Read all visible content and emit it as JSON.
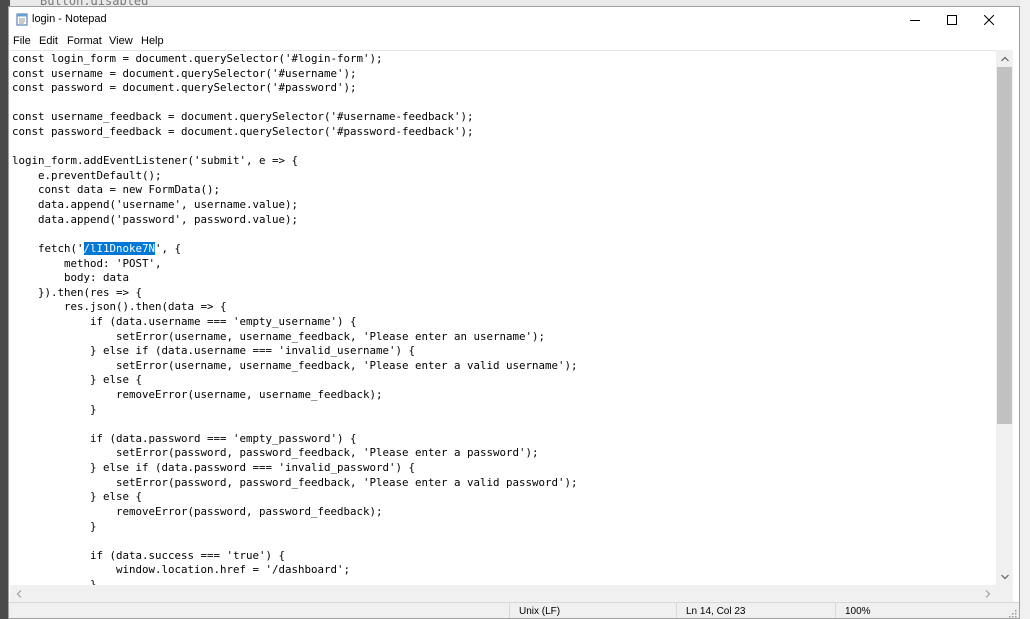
{
  "background": {
    "peek_text": "    Button.disabled"
  },
  "window": {
    "title": "login - Notepad"
  },
  "menu": {
    "items": [
      {
        "label": "File"
      },
      {
        "label": "Edit"
      },
      {
        "label": "Format"
      },
      {
        "label": "View"
      },
      {
        "label": "Help"
      }
    ]
  },
  "editor": {
    "selected_text": "/lI1Dnoke7N",
    "lines": [
      "const login_form = document.querySelector('#login-form');",
      "const username = document.querySelector('#username');",
      "const password = document.querySelector('#password');",
      "",
      "const username_feedback = document.querySelector('#username-feedback');",
      "const password_feedback = document.querySelector('#password-feedback');",
      "",
      "login_form.addEventListener('submit', e => {",
      "    e.preventDefault();",
      "    const data = new FormData();",
      "    data.append('username', username.value);",
      "    data.append('password', password.value);",
      "",
      "    fetch('",
      "        method: 'POST',",
      "        body: data",
      "    }).then(res => {",
      "        res.json().then(data => {",
      "            if (data.username === 'empty_username') {",
      "                setError(username, username_feedback, 'Please enter an username');",
      "            } else if (data.username === 'invalid_username') {",
      "                setError(username, username_feedback, 'Please enter a valid username');",
      "            } else {",
      "                removeError(username, username_feedback);",
      "            }",
      "",
      "            if (data.password === 'empty_password') {",
      "                setError(password, password_feedback, 'Please enter a password');",
      "            } else if (data.password === 'invalid_password') {",
      "                setError(password, password_feedback, 'Please enter a valid password');",
      "            } else {",
      "                removeError(password, password_feedback);",
      "            }",
      "",
      "            if (data.success === 'true') {",
      "                window.location.href = '/dashboard';",
      "            }"
    ],
    "fetch_line_suffix": "', {"
  },
  "status": {
    "line_ending": "Unix (LF)",
    "position": "Ln 14, Col 23",
    "zoom": "100%"
  },
  "colors": {
    "selection": "#0078d7",
    "scrollbar_track": "#f0f0f0",
    "scrollbar_thumb": "#c1c1c1"
  }
}
